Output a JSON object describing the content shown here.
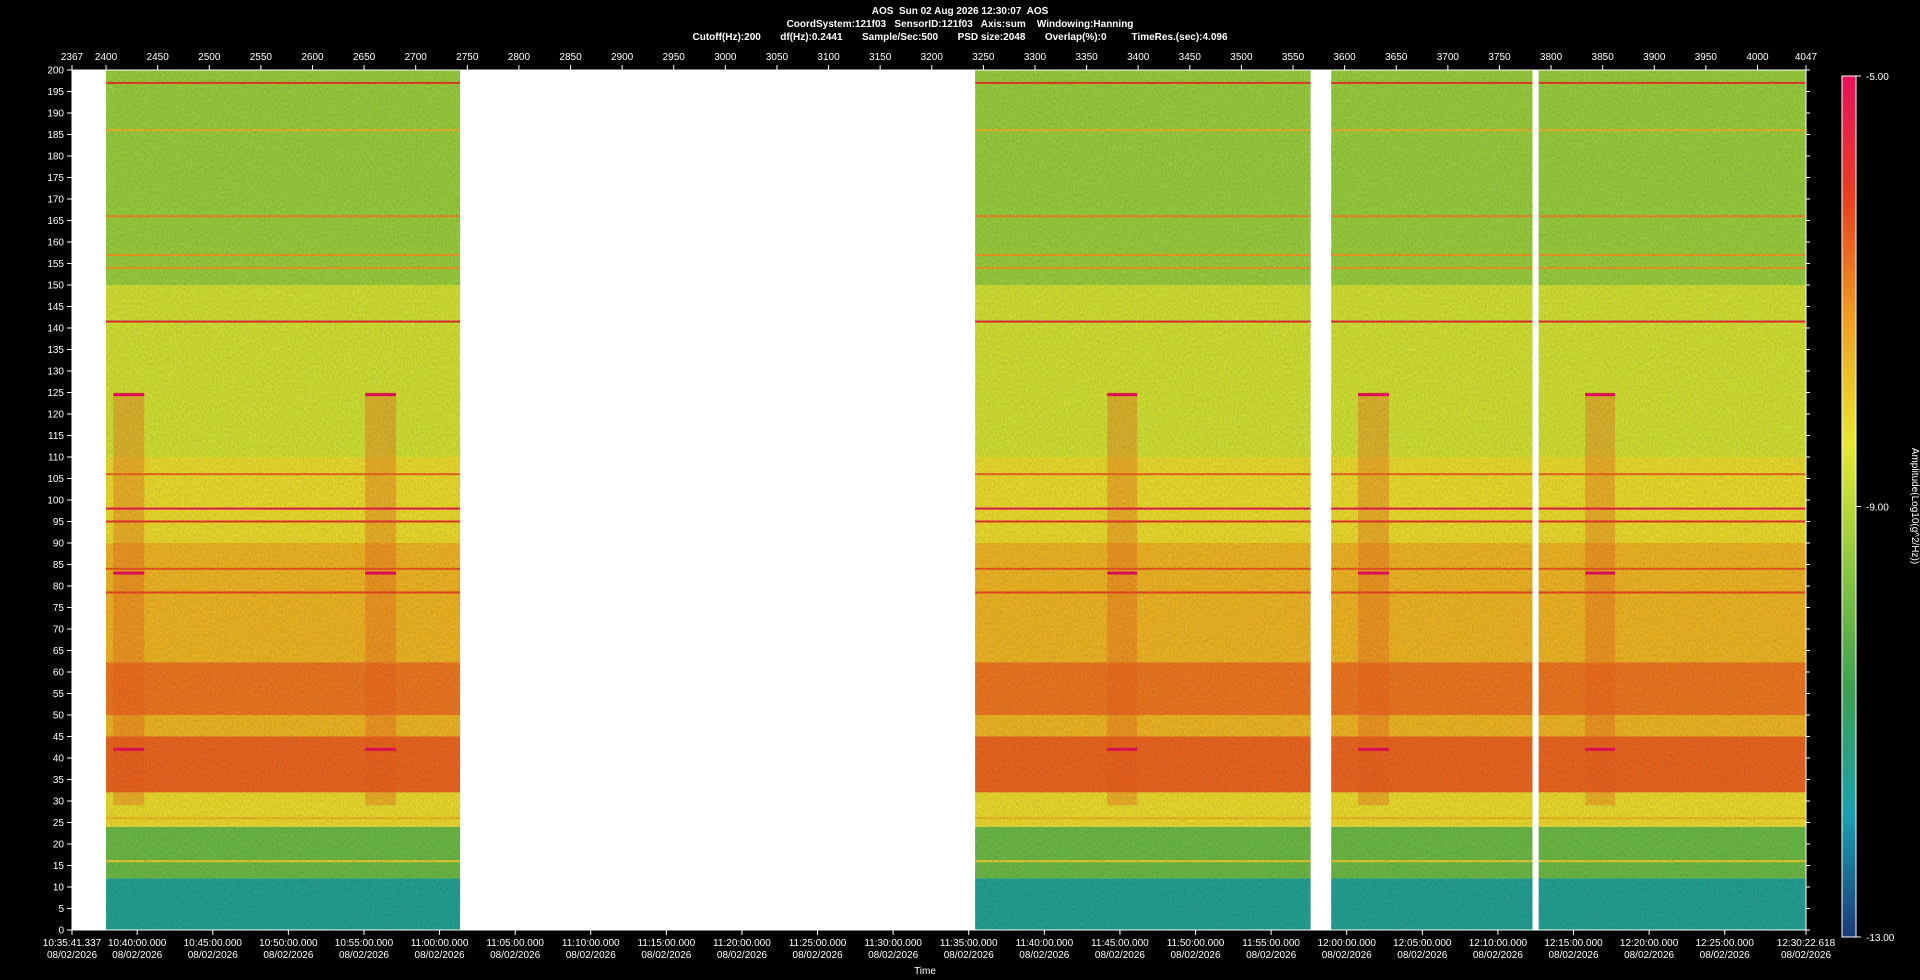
{
  "header": {
    "line1": "AOS  Sun 02 Aug 2026 12:30:07  AOS",
    "line2": "CoordSystem:121f03   SensorID:121f03   Axis:sum    Windowing:Hanning",
    "line3": "Cutoff(Hz):200       df(Hz):0.2441       Sample/Sec:500       PSD size:2048       Overlap(%):0         TimeRes.(sec):4.096"
  },
  "chart_data": {
    "type": "heatmap",
    "title": "",
    "xlabel": "Time",
    "ylabel": "",
    "colorbar_label": "Amplitude(Log10(g^2/Hz))",
    "colorbar_ticks": [
      "-5.00",
      "-9.00",
      "-13.00"
    ],
    "colorbar_range": [
      -13,
      -5
    ],
    "colormap": [
      "#1a3a7a",
      "#1aa0b0",
      "#3aa050",
      "#8ac840",
      "#e8e830",
      "#f0a020",
      "#e84020",
      "#e8105a"
    ],
    "ylim": [
      0,
      200
    ],
    "y_ticks": [
      0,
      5,
      10,
      15,
      20,
      25,
      30,
      35,
      40,
      45,
      50,
      55,
      60,
      65,
      70,
      75,
      80,
      85,
      90,
      95,
      100,
      105,
      110,
      115,
      120,
      125,
      130,
      135,
      140,
      145,
      150,
      155,
      160,
      165,
      170,
      175,
      180,
      185,
      190,
      195,
      200
    ],
    "top_axis_range": [
      2367,
      4047
    ],
    "top_axis_ticks": [
      "2367",
      "2400",
      "2450",
      "2500",
      "2550",
      "2600",
      "2650",
      "2700",
      "2750",
      "2800",
      "2850",
      "2900",
      "2950",
      "3000",
      "3050",
      "3100",
      "3150",
      "3200",
      "3250",
      "3300",
      "3350",
      "3400",
      "3450",
      "3500",
      "3550",
      "3600",
      "3650",
      "3700",
      "3750",
      "3800",
      "3850",
      "3900",
      "3950",
      "4000",
      "4047"
    ],
    "time_ticks": [
      {
        "time": "10:35:41.337",
        "date": "08/02/2026"
      },
      {
        "time": "10:40:00.000",
        "date": "08/02/2026"
      },
      {
        "time": "10:45:00.000",
        "date": "08/02/2026"
      },
      {
        "time": "10:50:00.000",
        "date": "08/02/2026"
      },
      {
        "time": "10:55:00.000",
        "date": "08/02/2026"
      },
      {
        "time": "11:00:00.000",
        "date": "08/02/2026"
      },
      {
        "time": "11:05:00.000",
        "date": "08/02/2026"
      },
      {
        "time": "11:10:00.000",
        "date": "08/02/2026"
      },
      {
        "time": "11:15:00.000",
        "date": "08/02/2026"
      },
      {
        "time": "11:20:00.000",
        "date": "08/02/2026"
      },
      {
        "time": "11:25:00.000",
        "date": "08/02/2026"
      },
      {
        "time": "11:30:00.000",
        "date": "08/02/2026"
      },
      {
        "time": "11:35:00.000",
        "date": "08/02/2026"
      },
      {
        "time": "11:40:00.000",
        "date": "08/02/2026"
      },
      {
        "time": "11:45:00.000",
        "date": "08/02/2026"
      },
      {
        "time": "11:50:00.000",
        "date": "08/02/2026"
      },
      {
        "time": "11:55:00.000",
        "date": "08/02/2026"
      },
      {
        "time": "12:00:00.000",
        "date": "08/02/2026"
      },
      {
        "time": "12:05:00.000",
        "date": "08/02/2026"
      },
      {
        "time": "12:10:00.000",
        "date": "08/02/2026"
      },
      {
        "time": "12:15:00.000",
        "date": "08/02/2026"
      },
      {
        "time": "12:20:00.000",
        "date": "08/02/2026"
      },
      {
        "time": "12:25:00.000",
        "date": "08/02/2026"
      },
      {
        "time": "12:30:22.618",
        "date": "08/02/2026"
      }
    ],
    "data_segments": [
      [
        2400,
        2743
      ],
      [
        3242,
        3567
      ],
      [
        3587,
        3782
      ],
      [
        3788,
        4047
      ]
    ],
    "spectral_bands": [
      {
        "f_min": 0,
        "f_max": 12,
        "level": -11.5
      },
      {
        "f_min": 12,
        "f_max": 24,
        "level": -10.0
      },
      {
        "f_min": 24,
        "f_max": 32,
        "level": -8.2
      },
      {
        "f_min": 32,
        "f_max": 45,
        "level": -6.6
      },
      {
        "f_min": 45,
        "f_max": 50,
        "level": -7.6
      },
      {
        "f_min": 50,
        "f_max": 62,
        "level": -6.8
      },
      {
        "f_min": 62,
        "f_max": 90,
        "level": -7.6
      },
      {
        "f_min": 90,
        "f_max": 110,
        "level": -8.2
      },
      {
        "f_min": 110,
        "f_max": 150,
        "level": -8.7
      },
      {
        "f_min": 150,
        "f_max": 200,
        "level": -9.4
      }
    ],
    "tonal_lines": [
      {
        "f": 197,
        "level": -6.0
      },
      {
        "f": 186,
        "level": -7.6
      },
      {
        "f": 166,
        "level": -7.0
      },
      {
        "f": 157,
        "level": -7.2
      },
      {
        "f": 154,
        "level": -7.2
      },
      {
        "f": 141.5,
        "level": -5.6
      },
      {
        "f": 106,
        "level": -6.6
      },
      {
        "f": 98,
        "level": -5.2
      },
      {
        "f": 95,
        "level": -5.8
      },
      {
        "f": 84,
        "level": -6.4
      },
      {
        "f": 78.5,
        "level": -6.2
      },
      {
        "f": 62,
        "level": -6.8
      },
      {
        "f": 26,
        "level": -7.6
      },
      {
        "f": 16,
        "level": -8.0
      }
    ],
    "bursts": [
      {
        "x_start": 2407,
        "x_end": 2437,
        "f_min": 29,
        "f_max": 125
      },
      {
        "x_start": 2651,
        "x_end": 2681,
        "f_min": 29,
        "f_max": 125
      },
      {
        "x_start": 3370,
        "x_end": 3399,
        "f_min": 29,
        "f_max": 125
      },
      {
        "x_start": 3613,
        "x_end": 3643,
        "f_min": 29,
        "f_max": 125
      },
      {
        "x_start": 3833,
        "x_end": 3862,
        "f_min": 29,
        "f_max": 125
      }
    ],
    "burst_lines": [
      {
        "f": 124.5
      },
      {
        "f": 83
      },
      {
        "f": 42
      }
    ]
  }
}
